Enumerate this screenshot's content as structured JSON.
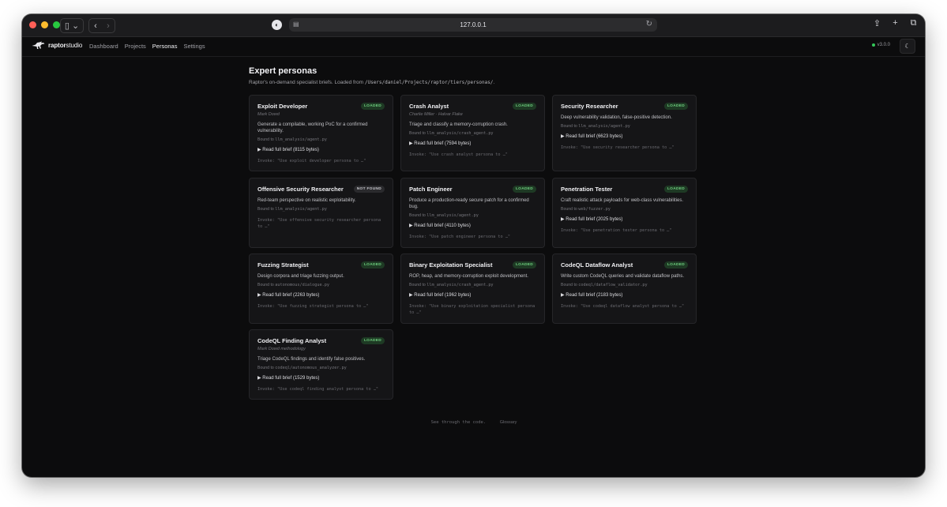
{
  "browser": {
    "url": "127.0.0.1"
  },
  "app": {
    "brand_bold": "raptor",
    "brand_light": "studio",
    "nav": [
      "Dashboard",
      "Projects",
      "Personas",
      "Settings"
    ],
    "active_nav": "Personas",
    "version": "v3.0.0"
  },
  "page": {
    "title": "Expert personas",
    "subtitle_prefix": "Raptor's on-demand specialist briefs. Loaded from",
    "subtitle_path": "/Users/daniel/Projects/raptor/tiers/personas/",
    "subtitle_suffix": "."
  },
  "cards": [
    {
      "title": "Exploit Developer",
      "status": "LOADED",
      "author": "Mark Dowd",
      "description": "Generate a compilable, working PoC for a confirmed vulnerability.",
      "bound_label": "Bound to",
      "bound": "llm_analysis/agent.py",
      "brief": "▶ Read full brief (8115 bytes)",
      "invoke": "Invoke: \"Use exploit developer persona to …\""
    },
    {
      "title": "Crash Analyst",
      "status": "LOADED",
      "author": "Charlie Miller · Halvar Flake",
      "description": "Triage and classify a memory-corruption crash.",
      "bound_label": "Bound to",
      "bound": "llm_analysis/crash_agent.py",
      "brief": "▶ Read full brief (7594 bytes)",
      "invoke": "Invoke: \"Use crash analyst persona to …\""
    },
    {
      "title": "Security Researcher",
      "status": "LOADED",
      "author": "",
      "description": "Deep vulnerability validation, false-positive detection.",
      "bound_label": "Bound to",
      "bound": "llm_analysis/agent.py",
      "brief": "▶ Read full brief (6623 bytes)",
      "invoke": "Invoke: \"Use security researcher persona to …\""
    },
    {
      "title": "Offensive Security Researcher",
      "status": "NOT FOUND",
      "author": "",
      "description": "Red-team perspective on realistic exploitability.",
      "bound_label": "Bound to",
      "bound": "llm_analysis/agent.py",
      "brief": "",
      "invoke": "Invoke: \"Use offensive security researcher persona to …\""
    },
    {
      "title": "Patch Engineer",
      "status": "LOADED",
      "author": "",
      "description": "Produce a production-ready secure patch for a confirmed bug.",
      "bound_label": "Bound to",
      "bound": "llm_analysis/agent.py",
      "brief": "▶ Read full brief (4110 bytes)",
      "invoke": "Invoke: \"Use patch engineer persona to …\""
    },
    {
      "title": "Penetration Tester",
      "status": "LOADED",
      "author": "",
      "description": "Craft realistic attack payloads for web-class vulnerabilities.",
      "bound_label": "Bound to",
      "bound": "web/fuzzer.py",
      "brief": "▶ Read full brief (2025 bytes)",
      "invoke": "Invoke: \"Use penetration tester persona to …\""
    },
    {
      "title": "Fuzzing Strategist",
      "status": "LOADED",
      "author": "",
      "description": "Design corpora and triage fuzzing output.",
      "bound_label": "Bound to",
      "bound": "autonomous/dialogue.py",
      "brief": "▶ Read full brief (2263 bytes)",
      "invoke": "Invoke: \"Use fuzzing strategist persona to …\""
    },
    {
      "title": "Binary Exploitation Specialist",
      "status": "LOADED",
      "author": "",
      "description": "ROP, heap, and memory-corruption exploit development.",
      "bound_label": "Bound to",
      "bound": "llm_analysis/crash_agent.py",
      "brief": "▶ Read full brief (1962 bytes)",
      "invoke": "Invoke: \"Use binary exploitation specialist persona to …\""
    },
    {
      "title": "CodeQL Dataflow Analyst",
      "status": "LOADED",
      "author": "",
      "description": "Write custom CodeQL queries and validate dataflow paths.",
      "bound_label": "Bound to",
      "bound": "codeql/dataflow_validator.py",
      "brief": "▶ Read full brief (2183 bytes)",
      "invoke": "Invoke: \"Use codeql dataflow analyst persona to …\""
    },
    {
      "title": "CodeQL Finding Analyst",
      "status": "LOADED",
      "author": "Mark Dowd methodology",
      "description": "Triage CodeQL findings and identify false positives.",
      "bound_label": "Bound to",
      "bound": "codeql/autonomous_analyzer.py",
      "brief": "▶ Read full brief (1529 bytes)",
      "invoke": "Invoke: \"Use codeql finding analyst persona to …\""
    }
  ],
  "footer": {
    "tagline": "See through the code.",
    "glossary": "Glossary"
  },
  "colors": {
    "background": "#0c0c0d",
    "card": "#151517",
    "loaded_badge": "#6fcf7f",
    "accent_green": "#34c759"
  },
  "icons": [
    "sidebar-icon",
    "chevron-left-icon",
    "chevron-right-icon",
    "shield-icon",
    "page-icon",
    "reload-icon",
    "share-icon",
    "plus-icon",
    "tabs-icon",
    "raptor-logo-icon",
    "moon-icon"
  ]
}
